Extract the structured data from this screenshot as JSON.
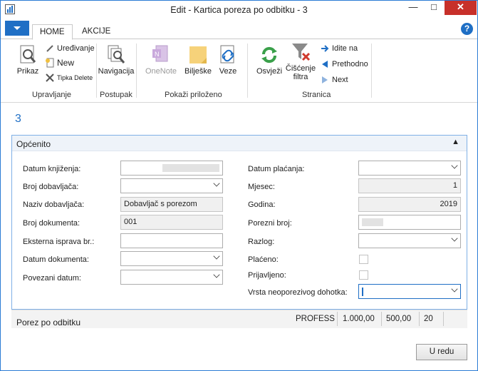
{
  "window": {
    "title": "Edit - Kartica poreza po odbitku - 3"
  },
  "tabs": {
    "home": "HOME",
    "akcije": "AKCIJE"
  },
  "ribbon": {
    "prikaz": "Prikaz",
    "uredivanje": "Uređivanje",
    "new": "New",
    "tipka_delete": "Tipka Delete",
    "navigacija": "Navigacija",
    "onenote": "OneNote",
    "biljeske": "Bilješke",
    "veze": "Veze",
    "osvjezi": "Osvježi",
    "ciscenje_filtra_1": "Čišćenje",
    "ciscenje_filtra_2": "filtra",
    "idite_na": "Idite na",
    "prethodno": "Prethodno",
    "next": "Next",
    "groups": {
      "upravljanje": "Upravljanje",
      "postupak": "Postupak",
      "pokazi_prilozeno": "Pokaži priloženo",
      "stranica": "Stranica"
    }
  },
  "record": {
    "number": "3"
  },
  "section": {
    "title": "Općenito"
  },
  "fields": {
    "datum_knjizenja": {
      "label": "Datum knjiženja:",
      "value": ""
    },
    "broj_dobavljaca": {
      "label": "Broj dobavljača:",
      "value": ""
    },
    "naziv_dobavljaca": {
      "label": "Naziv dobavljača:",
      "value": "Dobavljač s porezom"
    },
    "broj_dokumenta": {
      "label": "Broj dokumenta:",
      "value": "001"
    },
    "eksterna_isprava": {
      "label": "Eksterna isprava br.:",
      "value": ""
    },
    "datum_dokumenta": {
      "label": "Datum dokumenta:",
      "value": ""
    },
    "povezani_datum": {
      "label": "Povezani datum:",
      "value": ""
    },
    "datum_placanja": {
      "label": "Datum plaćanja:",
      "value": ""
    },
    "mjesec": {
      "label": "Mjesec:",
      "value": "1"
    },
    "godina": {
      "label": "Godina:",
      "value": "2019"
    },
    "porezni_broj": {
      "label": "Porezni broj:",
      "value": ""
    },
    "razlog": {
      "label": "Razlog:",
      "value": ""
    },
    "placeno": {
      "label": "Plaćeno:"
    },
    "prijavljeno": {
      "label": "Prijavljeno:"
    },
    "vrsta_neoporezivog": {
      "label": "Vrsta neoporezivog dohotka:",
      "value": ""
    }
  },
  "subpage": {
    "title": "Porez po odbitku",
    "facts": [
      "PROFESS",
      "1.000,00",
      "500,00",
      "20"
    ]
  },
  "ok_button": "U redu",
  "colors": {
    "accent": "#1f6fc5",
    "close": "#c7302a"
  }
}
